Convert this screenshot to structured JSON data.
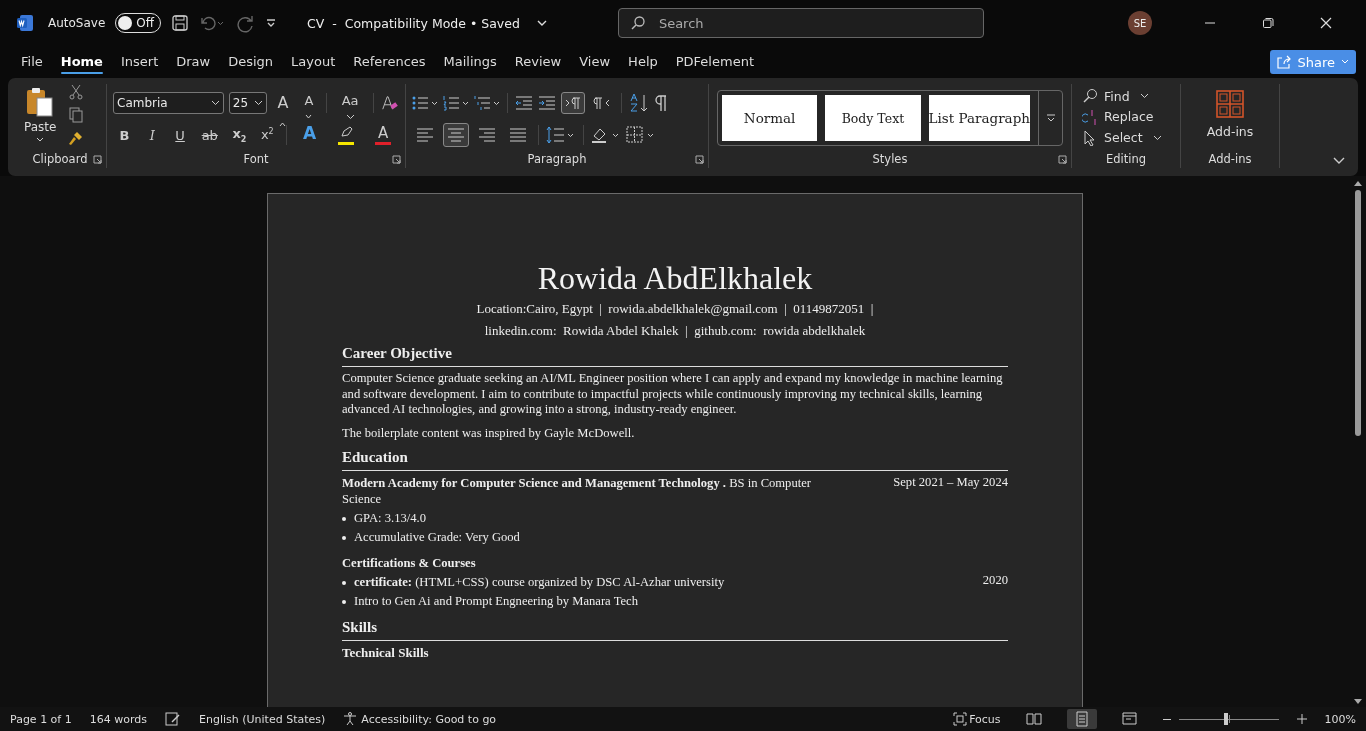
{
  "title_bar": {
    "autosave_label": "AutoSave",
    "autosave": {
      "on": false,
      "label": "Off"
    },
    "document_title": "CV  -  Compatibility Mode • Saved",
    "search": {
      "placeholder": "Search"
    },
    "avatar": "SE"
  },
  "menu_tabs": [
    {
      "label": "File",
      "selected": false
    },
    {
      "label": "Home",
      "selected": true
    },
    {
      "label": "Insert",
      "selected": false
    },
    {
      "label": "Draw",
      "selected": false
    },
    {
      "label": "Design",
      "selected": false
    },
    {
      "label": "Layout",
      "selected": false
    },
    {
      "label": "References",
      "selected": false
    },
    {
      "label": "Mailings",
      "selected": false
    },
    {
      "label": "Review",
      "selected": false
    },
    {
      "label": "View",
      "selected": false
    },
    {
      "label": "Help",
      "selected": false
    },
    {
      "label": "PDFelement",
      "selected": false
    }
  ],
  "share_button": "Share",
  "ribbon": {
    "clipboard": {
      "paste": "Paste",
      "label": "Clipboard"
    },
    "font": {
      "family": "Cambria",
      "size": "25",
      "label": "Font",
      "case_button": "Aa",
      "grow": "A",
      "shrink": "A",
      "format_buttons": [
        {
          "kind": "bold",
          "glyph": "B"
        },
        {
          "kind": "italic",
          "glyph": "I"
        },
        {
          "kind": "underline",
          "glyph": "U"
        },
        {
          "kind": "strike",
          "glyph": "ab"
        },
        {
          "kind": "sub",
          "glyph": "x",
          "index": "2"
        },
        {
          "kind": "sup",
          "glyph": "x",
          "index": "2"
        }
      ],
      "color_buttons": [
        {
          "kind": "effects",
          "glyph": "A",
          "color": "#4a9fe8"
        },
        {
          "kind": "highlight",
          "color": "#f5e600"
        },
        {
          "kind": "font-color",
          "glyph": "A",
          "color": "#e0202a"
        }
      ]
    },
    "paragraph": {
      "label": "Paragraph",
      "ltr": {
        "selected": true
      },
      "rtl": {
        "selected": false
      },
      "alignments": [
        {
          "kind": "left",
          "selected": false
        },
        {
          "kind": "center",
          "selected": true
        },
        {
          "kind": "right",
          "selected": false
        },
        {
          "kind": "justify",
          "selected": false
        }
      ]
    },
    "styles": {
      "label": "Styles",
      "items": [
        "Normal",
        "Body Text",
        "List Paragraph"
      ]
    },
    "editing": {
      "label": "Editing",
      "items": [
        {
          "kind": "find",
          "label": "Find"
        },
        {
          "kind": "replace",
          "label": "Replace"
        },
        {
          "kind": "select",
          "label": "Select"
        }
      ]
    },
    "addins": {
      "label": "Add-ins",
      "button": "Add-ins"
    }
  },
  "document": {
    "name": "Rowida AbdElkhalek",
    "contact_lines": [
      "Location:Cairo, Egypt  |  rowida.abdelkhalek@gmail.com  |  01149872051  |",
      "linkedin.com:  Rowida Abdel Khalek  |  github.com:  rowida abdelkhalek"
    ],
    "sections": [
      {
        "heading": "Career Objective",
        "blocks": [
          {
            "kind": "paragraph",
            "text": "Computer Science graduate seeking an AI/ML Engineer position where I can apply and expand my knowledge in machine learning and software development.  I aim to contribute to impactful projects while continuously improving my technical skills, learning advanced AI technologies, and growing into a strong, industry-ready engineer."
          },
          {
            "kind": "paragraph",
            "text": "The boilerplate content was inspired by Gayle McDowell."
          }
        ]
      },
      {
        "heading": "Education",
        "blocks": [
          {
            "kind": "entry",
            "title": "**Modern Academy for Computer Science and Management Technology .** BS in Computer Science",
            "date": "Sept 2021 – May 2024",
            "bullets": [
              "GPA: 3.13/4.0",
              "Accumulative Grade: Very Good"
            ]
          },
          {
            "kind": "entry",
            "title": "**Certifications & Courses**",
            "date": "2020",
            "bullets": [
              "**certificate:**  (HTML+CSS) course organized by DSC Al-Azhar university",
              "Intro to Gen Ai and Prompt Engneering by Manara Tech"
            ]
          }
        ]
      },
      {
        "heading": "Skills",
        "blocks": [
          {
            "kind": "subheading",
            "text": "Technical Skills"
          }
        ]
      }
    ]
  },
  "status_bar": {
    "page": "Page 1 of 1",
    "words": "164 words",
    "language": "English (United States)",
    "accessibility": "Accessibility: Good to go",
    "focus": "Focus",
    "views": [
      {
        "kind": "read",
        "selected": false
      },
      {
        "kind": "print",
        "selected": true
      },
      {
        "kind": "web",
        "selected": false
      }
    ],
    "zoom": {
      "level": 0.47,
      "label": "100%"
    }
  }
}
